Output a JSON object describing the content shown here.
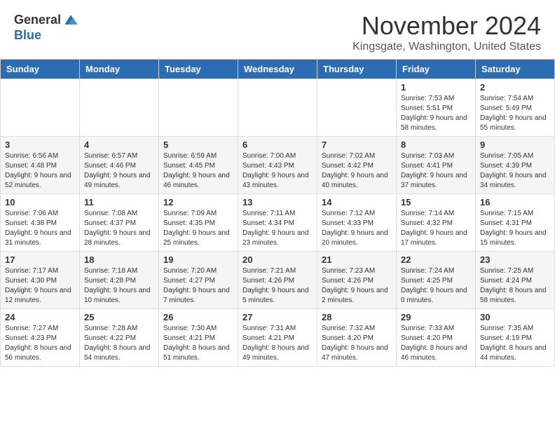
{
  "header": {
    "logo_general": "General",
    "logo_blue": "Blue",
    "month_title": "November 2024",
    "location": "Kingsgate, Washington, United States"
  },
  "weekdays": [
    "Sunday",
    "Monday",
    "Tuesday",
    "Wednesday",
    "Thursday",
    "Friday",
    "Saturday"
  ],
  "weeks": [
    [
      {
        "day": "",
        "sunrise": "",
        "sunset": "",
        "daylight": ""
      },
      {
        "day": "",
        "sunrise": "",
        "sunset": "",
        "daylight": ""
      },
      {
        "day": "",
        "sunrise": "",
        "sunset": "",
        "daylight": ""
      },
      {
        "day": "",
        "sunrise": "",
        "sunset": "",
        "daylight": ""
      },
      {
        "day": "",
        "sunrise": "",
        "sunset": "",
        "daylight": ""
      },
      {
        "day": "1",
        "sunrise": "Sunrise: 7:53 AM",
        "sunset": "Sunset: 5:51 PM",
        "daylight": "Daylight: 9 hours and 58 minutes."
      },
      {
        "day": "2",
        "sunrise": "Sunrise: 7:54 AM",
        "sunset": "Sunset: 5:49 PM",
        "daylight": "Daylight: 9 hours and 55 minutes."
      }
    ],
    [
      {
        "day": "3",
        "sunrise": "Sunrise: 6:56 AM",
        "sunset": "Sunset: 4:48 PM",
        "daylight": "Daylight: 9 hours and 52 minutes."
      },
      {
        "day": "4",
        "sunrise": "Sunrise: 6:57 AM",
        "sunset": "Sunset: 4:46 PM",
        "daylight": "Daylight: 9 hours and 49 minutes."
      },
      {
        "day": "5",
        "sunrise": "Sunrise: 6:59 AM",
        "sunset": "Sunset: 4:45 PM",
        "daylight": "Daylight: 9 hours and 46 minutes."
      },
      {
        "day": "6",
        "sunrise": "Sunrise: 7:00 AM",
        "sunset": "Sunset: 4:43 PM",
        "daylight": "Daylight: 9 hours and 43 minutes."
      },
      {
        "day": "7",
        "sunrise": "Sunrise: 7:02 AM",
        "sunset": "Sunset: 4:42 PM",
        "daylight": "Daylight: 9 hours and 40 minutes."
      },
      {
        "day": "8",
        "sunrise": "Sunrise: 7:03 AM",
        "sunset": "Sunset: 4:41 PM",
        "daylight": "Daylight: 9 hours and 37 minutes."
      },
      {
        "day": "9",
        "sunrise": "Sunrise: 7:05 AM",
        "sunset": "Sunset: 4:39 PM",
        "daylight": "Daylight: 9 hours and 34 minutes."
      }
    ],
    [
      {
        "day": "10",
        "sunrise": "Sunrise: 7:06 AM",
        "sunset": "Sunset: 4:38 PM",
        "daylight": "Daylight: 9 hours and 31 minutes."
      },
      {
        "day": "11",
        "sunrise": "Sunrise: 7:08 AM",
        "sunset": "Sunset: 4:37 PM",
        "daylight": "Daylight: 9 hours and 28 minutes."
      },
      {
        "day": "12",
        "sunrise": "Sunrise: 7:09 AM",
        "sunset": "Sunset: 4:35 PM",
        "daylight": "Daylight: 9 hours and 25 minutes."
      },
      {
        "day": "13",
        "sunrise": "Sunrise: 7:11 AM",
        "sunset": "Sunset: 4:34 PM",
        "daylight": "Daylight: 9 hours and 23 minutes."
      },
      {
        "day": "14",
        "sunrise": "Sunrise: 7:12 AM",
        "sunset": "Sunset: 4:33 PM",
        "daylight": "Daylight: 9 hours and 20 minutes."
      },
      {
        "day": "15",
        "sunrise": "Sunrise: 7:14 AM",
        "sunset": "Sunset: 4:32 PM",
        "daylight": "Daylight: 9 hours and 17 minutes."
      },
      {
        "day": "16",
        "sunrise": "Sunrise: 7:15 AM",
        "sunset": "Sunset: 4:31 PM",
        "daylight": "Daylight: 9 hours and 15 minutes."
      }
    ],
    [
      {
        "day": "17",
        "sunrise": "Sunrise: 7:17 AM",
        "sunset": "Sunset: 4:30 PM",
        "daylight": "Daylight: 9 hours and 12 minutes."
      },
      {
        "day": "18",
        "sunrise": "Sunrise: 7:18 AM",
        "sunset": "Sunset: 4:28 PM",
        "daylight": "Daylight: 9 hours and 10 minutes."
      },
      {
        "day": "19",
        "sunrise": "Sunrise: 7:20 AM",
        "sunset": "Sunset: 4:27 PM",
        "daylight": "Daylight: 9 hours and 7 minutes."
      },
      {
        "day": "20",
        "sunrise": "Sunrise: 7:21 AM",
        "sunset": "Sunset: 4:26 PM",
        "daylight": "Daylight: 9 hours and 5 minutes."
      },
      {
        "day": "21",
        "sunrise": "Sunrise: 7:23 AM",
        "sunset": "Sunset: 4:26 PM",
        "daylight": "Daylight: 9 hours and 2 minutes."
      },
      {
        "day": "22",
        "sunrise": "Sunrise: 7:24 AM",
        "sunset": "Sunset: 4:25 PM",
        "daylight": "Daylight: 9 hours and 0 minutes."
      },
      {
        "day": "23",
        "sunrise": "Sunrise: 7:25 AM",
        "sunset": "Sunset: 4:24 PM",
        "daylight": "Daylight: 8 hours and 58 minutes."
      }
    ],
    [
      {
        "day": "24",
        "sunrise": "Sunrise: 7:27 AM",
        "sunset": "Sunset: 4:23 PM",
        "daylight": "Daylight: 8 hours and 56 minutes."
      },
      {
        "day": "25",
        "sunrise": "Sunrise: 7:28 AM",
        "sunset": "Sunset: 4:22 PM",
        "daylight": "Daylight: 8 hours and 54 minutes."
      },
      {
        "day": "26",
        "sunrise": "Sunrise: 7:30 AM",
        "sunset": "Sunset: 4:21 PM",
        "daylight": "Daylight: 8 hours and 51 minutes."
      },
      {
        "day": "27",
        "sunrise": "Sunrise: 7:31 AM",
        "sunset": "Sunset: 4:21 PM",
        "daylight": "Daylight: 8 hours and 49 minutes."
      },
      {
        "day": "28",
        "sunrise": "Sunrise: 7:32 AM",
        "sunset": "Sunset: 4:20 PM",
        "daylight": "Daylight: 8 hours and 47 minutes."
      },
      {
        "day": "29",
        "sunrise": "Sunrise: 7:33 AM",
        "sunset": "Sunset: 4:20 PM",
        "daylight": "Daylight: 8 hours and 46 minutes."
      },
      {
        "day": "30",
        "sunrise": "Sunrise: 7:35 AM",
        "sunset": "Sunset: 4:19 PM",
        "daylight": "Daylight: 8 hours and 44 minutes."
      }
    ]
  ]
}
